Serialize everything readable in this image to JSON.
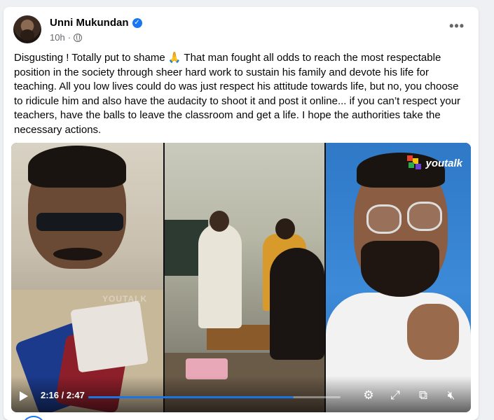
{
  "post": {
    "author": "Unni Mukundan",
    "time": "10h",
    "more_icon": "more-options-icon",
    "text": "Disgusting ! Totally put to shame 🙏 That man fought all odds to reach the most respectable position in the society through sheer hard work to sustain his family and devote his life for teaching. All you low lives could do was just respect his attitude towards life, but no, you choose to ridicule him and also have the audacity to shoot it and post it online... if you can’t respect your teachers, have the balls to leave the classroom and get a life. I hope the authorities take the necessary actions."
  },
  "video": {
    "brand": "youtalk",
    "watermark": "YOUTALK",
    "time_display": "2:16 / 2:47",
    "progress_fraction": 0.815
  },
  "colors": {
    "accent": "#1877f2",
    "text": "#050505",
    "muted": "#65676b"
  }
}
